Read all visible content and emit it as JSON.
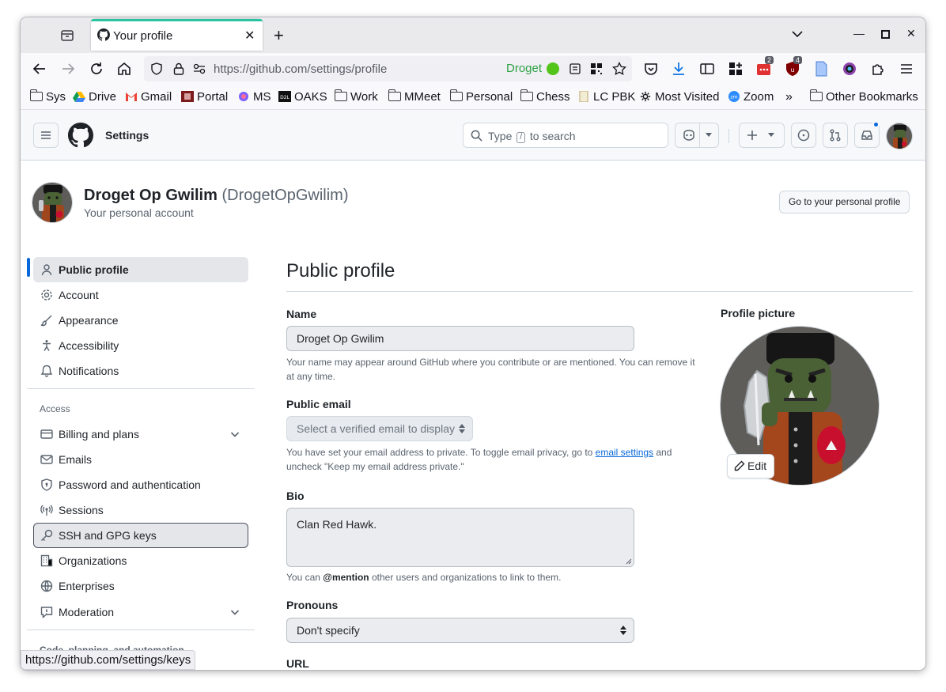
{
  "browser": {
    "tab_title": "Your profile",
    "url_host": "https://github.com",
    "url_path": "/settings/profile",
    "container_label": "Droget",
    "badges": {
      "ext_todo": "2",
      "ext_ublock": "4"
    },
    "status_url": "https://github.com/settings/keys"
  },
  "bookmarks": [
    {
      "label": "Sys",
      "icon": "folder-icon"
    },
    {
      "label": "Drive",
      "icon": "google-drive-icon"
    },
    {
      "label": "Gmail",
      "icon": "gmail-icon"
    },
    {
      "label": "Portal",
      "icon": "portal-icon"
    },
    {
      "label": "MS",
      "icon": "microsoft-icon"
    },
    {
      "label": "OAKS",
      "icon": "d2l-icon"
    },
    {
      "label": "Work",
      "icon": "folder-icon"
    },
    {
      "label": "MMeet",
      "icon": "folder-icon"
    },
    {
      "label": "Personal",
      "icon": "folder-icon"
    },
    {
      "label": "Chess",
      "icon": "folder-icon"
    },
    {
      "label": "LC PBK",
      "icon": "page-icon"
    },
    {
      "label": "Most Visited",
      "icon": "gear-icon"
    },
    {
      "label": "Zoom",
      "icon": "zoom-icon"
    },
    {
      "label": "Other Bookmarks",
      "icon": "folder-icon"
    }
  ],
  "header": {
    "title": "Settings",
    "search_prefix": "Type",
    "search_key": "/",
    "search_suffix": "to search"
  },
  "account": {
    "name": "Droget Op Gwilim",
    "login": "(DrogetOpGwilim)",
    "subtitle": "Your personal account",
    "goto_label": "Go to your personal profile"
  },
  "sidebar": {
    "items_top": [
      {
        "label": "Public profile",
        "icon": "person-icon"
      },
      {
        "label": "Account",
        "icon": "gear-icon"
      },
      {
        "label": "Appearance",
        "icon": "paintbrush-icon"
      },
      {
        "label": "Accessibility",
        "icon": "accessibility-icon"
      },
      {
        "label": "Notifications",
        "icon": "bell-icon"
      }
    ],
    "access_heading": "Access",
    "items_access": [
      {
        "label": "Billing and plans",
        "icon": "credit-card-icon"
      },
      {
        "label": "Emails",
        "icon": "mail-icon"
      },
      {
        "label": "Password and authentication",
        "icon": "shield-lock-icon"
      },
      {
        "label": "Sessions",
        "icon": "broadcast-icon"
      },
      {
        "label": "SSH and GPG keys",
        "icon": "key-icon"
      },
      {
        "label": "Organizations",
        "icon": "organization-icon"
      },
      {
        "label": "Enterprises",
        "icon": "globe-icon"
      },
      {
        "label": "Moderation",
        "icon": "report-icon"
      }
    ],
    "code_heading": "Code, planning, and automation"
  },
  "main": {
    "title": "Public profile",
    "name_label": "Name",
    "name_value": "Droget Op Gwilim",
    "name_note": "Your name may appear around GitHub where you contribute or are mentioned. You can remove it at any time.",
    "email_label": "Public email",
    "email_select": "Select a verified email to display",
    "email_note_1": "You have set your email address to private. To toggle email privacy, go to ",
    "email_note_link": "email settings",
    "email_note_2": " and uncheck \"Keep my email address private.\"",
    "bio_label": "Bio",
    "bio_value": "Clan Red Hawk.",
    "bio_note_1": "You can ",
    "bio_note_mention": "@mention",
    "bio_note_2": " other users and organizations to link to them.",
    "pronouns_label": "Pronouns",
    "pronouns_value": "Don't specify",
    "url_label": "URL",
    "picture_label": "Profile picture",
    "edit_label": "Edit"
  }
}
